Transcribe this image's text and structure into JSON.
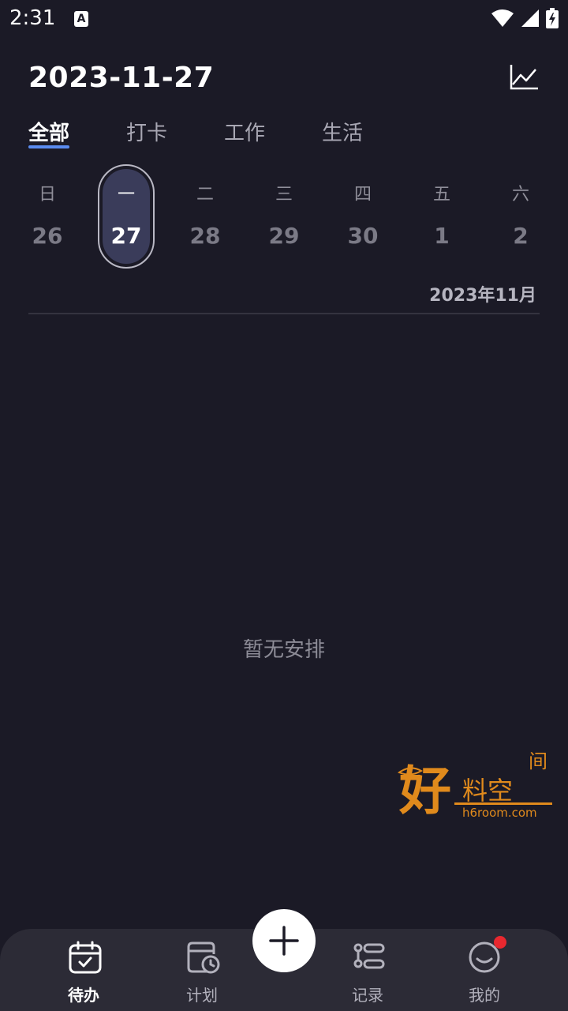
{
  "status_bar": {
    "time": "2:31"
  },
  "header": {
    "date": "2023-11-27"
  },
  "tabs": [
    {
      "label": "全部"
    },
    {
      "label": "打卡"
    },
    {
      "label": "工作"
    },
    {
      "label": "生活"
    }
  ],
  "week": {
    "days": [
      {
        "weekday": "日",
        "day": "26"
      },
      {
        "weekday": "一",
        "day": "27"
      },
      {
        "weekday": "二",
        "day": "28"
      },
      {
        "weekday": "三",
        "day": "29"
      },
      {
        "weekday": "四",
        "day": "30"
      },
      {
        "weekday": "五",
        "day": "1"
      },
      {
        "weekday": "六",
        "day": "2"
      }
    ],
    "month_label": "2023年11月"
  },
  "empty_state": {
    "text": "暂无安排"
  },
  "watermark": {
    "big_char": "好",
    "chars": "料空",
    "top_char": "间",
    "domain": "h6room.com"
  },
  "bottom_nav": {
    "items": [
      {
        "label": "待办"
      },
      {
        "label": "计划"
      },
      {
        "label": "记录"
      },
      {
        "label": "我的"
      }
    ]
  },
  "colors": {
    "background": "#1b1a26",
    "accent_underline": "#5b8cf0",
    "selected_day": "#3a3c5a",
    "badge": "#e8282f",
    "watermark": "#e08a1c"
  }
}
